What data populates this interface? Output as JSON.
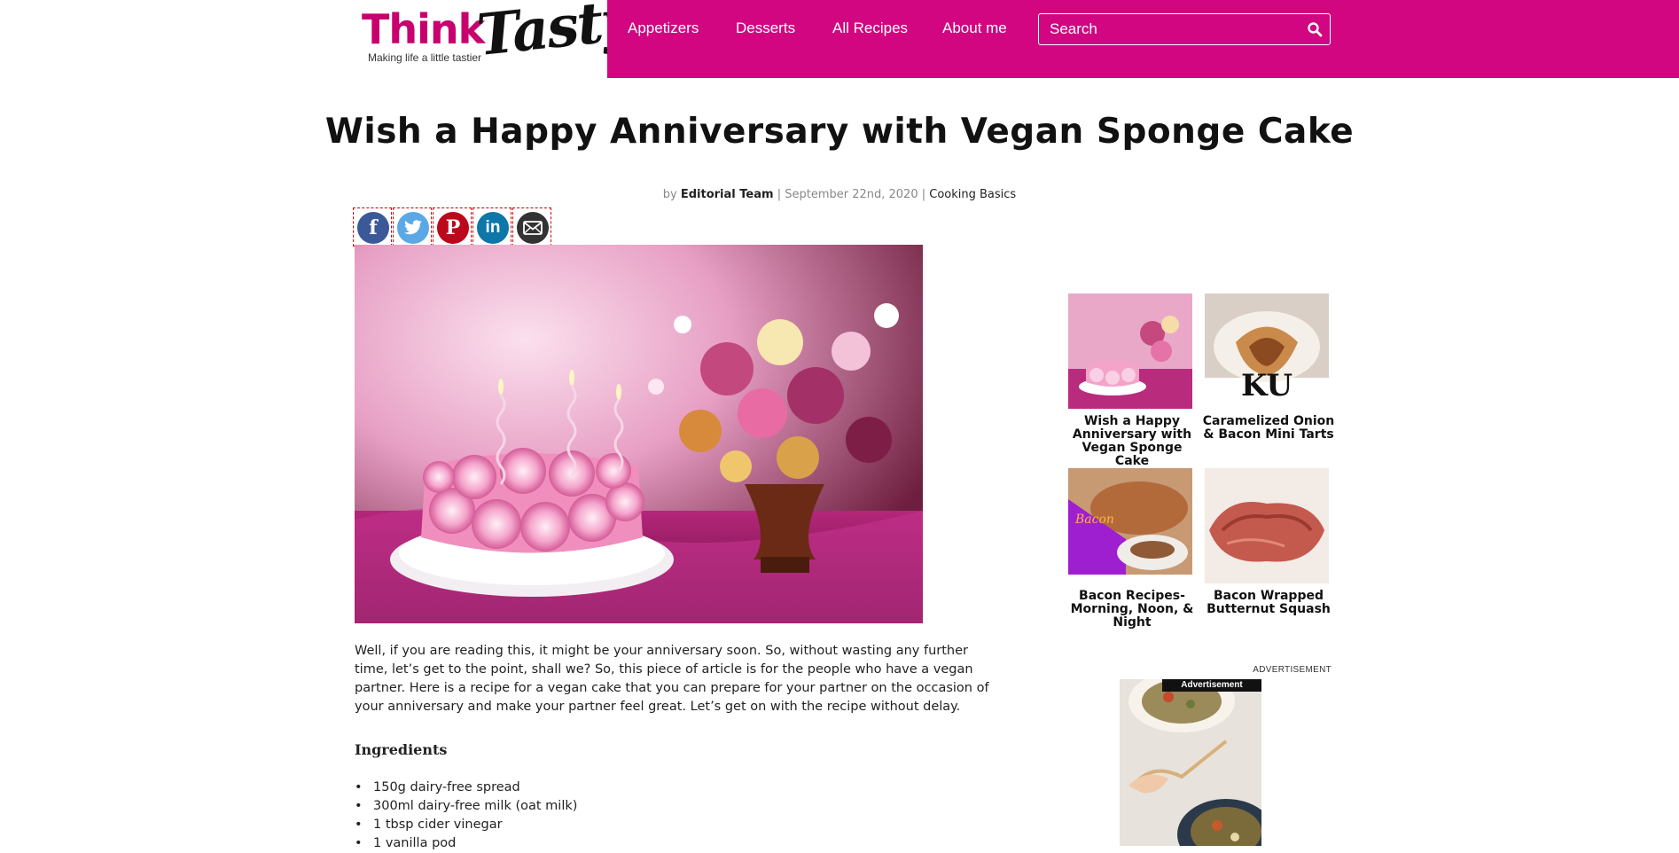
{
  "logo": {
    "brand_think": "Think",
    "brand_tasty": "Tasty",
    "tagline": "Making life a little tastier"
  },
  "nav": [
    {
      "label": "Appetizers"
    },
    {
      "label": "Desserts"
    },
    {
      "label": "All Recipes"
    },
    {
      "label": "About me"
    }
  ],
  "search": {
    "placeholder": "Search",
    "icon": "search-icon"
  },
  "article": {
    "title": "Wish a Happy Anniversary with Vegan Sponge Cake",
    "byline_prefix": "by",
    "author": "Editorial Team",
    "separator": "|",
    "date": "September 22nd, 2020",
    "category": "Cooking Basics",
    "intro": "Well, if you are reading this, it might be your anniversary soon. So, without wasting any further time, let’s get to the point, shall we? So, this piece of article is for the people who have a vegan partner. Here is a recipe for a vegan cake that you can prepare for your partner on the occasion of your anniversary and make your partner feel great. Let’s get on with the recipe without delay.",
    "ingredients_heading": "Ingredients",
    "ingredients": [
      "150g dairy-free spread",
      "300ml dairy-free milk (oat milk)",
      "1 tbsp cider vinegar",
      "1 vanilla pod"
    ]
  },
  "share": [
    {
      "icon": "facebook-icon",
      "glyph": "f",
      "color": "#3b5998"
    },
    {
      "icon": "twitter-icon",
      "glyph": "t",
      "color": "#5aa9e6"
    },
    {
      "icon": "pinterest-icon",
      "glyph": "P",
      "color": "#bd081c"
    },
    {
      "icon": "linkedin-icon",
      "glyph": "in",
      "color": "#0e76a8"
    },
    {
      "icon": "email-icon",
      "glyph": "✉",
      "color": "#333333"
    }
  ],
  "sidebar": {
    "cards": [
      {
        "caption": "Wish a Happy Anniversary with Vegan Sponge Cake"
      },
      {
        "caption": "Caramelized Onion & Bacon Mini Tarts",
        "thumb_overlay": "KU"
      },
      {
        "caption": "Bacon Recipes- Morning, Noon, & Night",
        "thumb_overlay": "Bacon"
      },
      {
        "caption": "Bacon Wrapped Butternut Squash"
      }
    ],
    "ad_label": "ADVERTISEMENT",
    "ad_tag": "Advertisement"
  },
  "colors": {
    "brand": "#d10680",
    "logo_pink": "#c8006e"
  }
}
